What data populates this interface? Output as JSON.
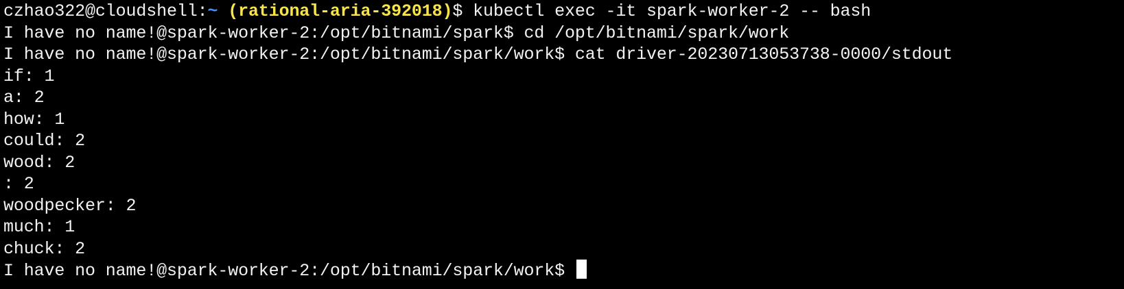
{
  "terminal": {
    "line1": {
      "user_host": "czhao322@cloudshell:",
      "tilde": "~",
      "space1": " ",
      "project": "(rational-aria-392018)",
      "command": "$ kubectl exec -it spark-worker-2 -- bash"
    },
    "line2": "I have no name!@spark-worker-2:/opt/bitnami/spark$ cd /opt/bitnami/spark/work",
    "line3": "I have no name!@spark-worker-2:/opt/bitnami/spark/work$ cat driver-20230713053738-0000/stdout",
    "output": [
      "if: 1",
      "a: 2",
      "how: 1",
      "could: 2",
      "wood: 2",
      ": 2",
      "woodpecker: 2",
      "much: 1",
      "chuck: 2"
    ],
    "prompt": "I have no name!@spark-worker-2:/opt/bitnami/spark/work$ "
  }
}
